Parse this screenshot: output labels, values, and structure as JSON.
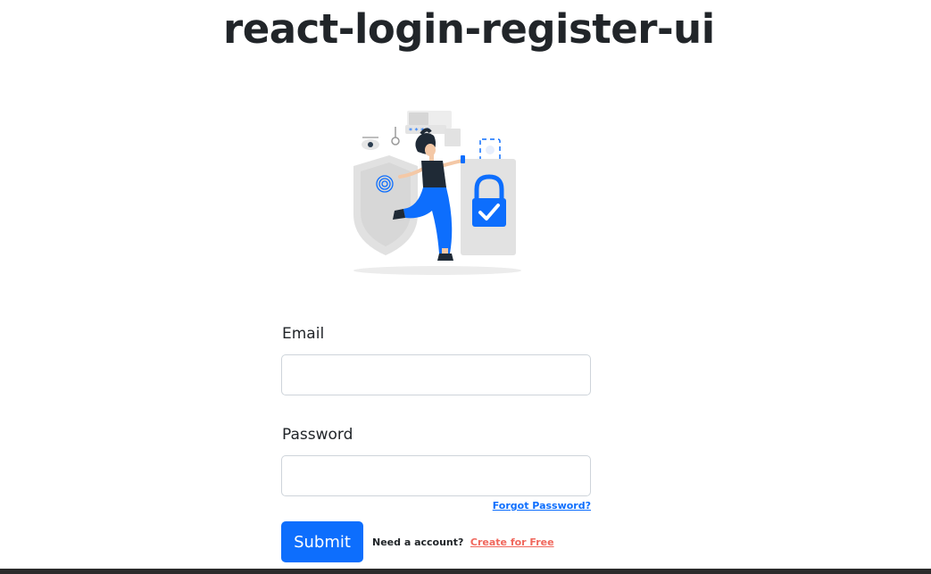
{
  "page": {
    "title": "react-login-register-ui"
  },
  "illustration": {
    "name": "security-login-illustration",
    "stars": "* * * *"
  },
  "form": {
    "email": {
      "label": "Email",
      "value": "",
      "placeholder": ""
    },
    "password": {
      "label": "Password",
      "value": "",
      "placeholder": ""
    },
    "forgot_password_link": "Forgot Password?",
    "submit_label": "Submit",
    "need_account_text": "Need a account?",
    "create_account_link": "Create for Free"
  },
  "colors": {
    "primary": "#0d6efd",
    "link_accent": "#f0675c",
    "text": "#212529",
    "input_border": "#ced4da"
  }
}
